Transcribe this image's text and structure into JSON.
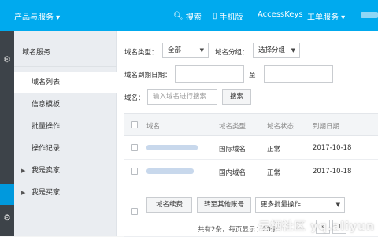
{
  "topbar": {
    "product_label": "产品与服务 ▾",
    "search_label": "搜索",
    "mobile_label": "手机版",
    "accesskeys_label": "AccessKeys",
    "workorder_label": "工单服务 ▾"
  },
  "sidebar": {
    "title": "域名服务",
    "items": [
      {
        "label": "域名列表"
      },
      {
        "label": "信息模板"
      },
      {
        "label": "批量操作"
      },
      {
        "label": "操作记录"
      },
      {
        "label": "我是卖家"
      },
      {
        "label": "我是买家"
      }
    ]
  },
  "filters": {
    "type_label": "域名类型：",
    "type_value": "全部",
    "group_label": "域名分组：",
    "group_value": "选择分组",
    "expire_label": "域名到期日期：",
    "to_label": "至",
    "name_label": "域名：",
    "name_placeholder": "输入域名进行搜索",
    "search_button": "搜索"
  },
  "table": {
    "headers": [
      "域名",
      "域名类型",
      "域名状态",
      "到期日期"
    ],
    "rows": [
      {
        "type": "国际域名",
        "status": "正常",
        "expire": "2017-10-18"
      },
      {
        "type": "国内域名",
        "status": "正常",
        "expire": "2017-10-18"
      }
    ]
  },
  "actions": {
    "renew_button": "域名续费",
    "transfer_button": "转至其他账号",
    "batch_label": "更多批量操作",
    "page_info": "共有2条，每页显示：20条",
    "page_prev": "‹",
    "page_current": "1"
  },
  "watermark": "云栖社区 yq.aliyun"
}
